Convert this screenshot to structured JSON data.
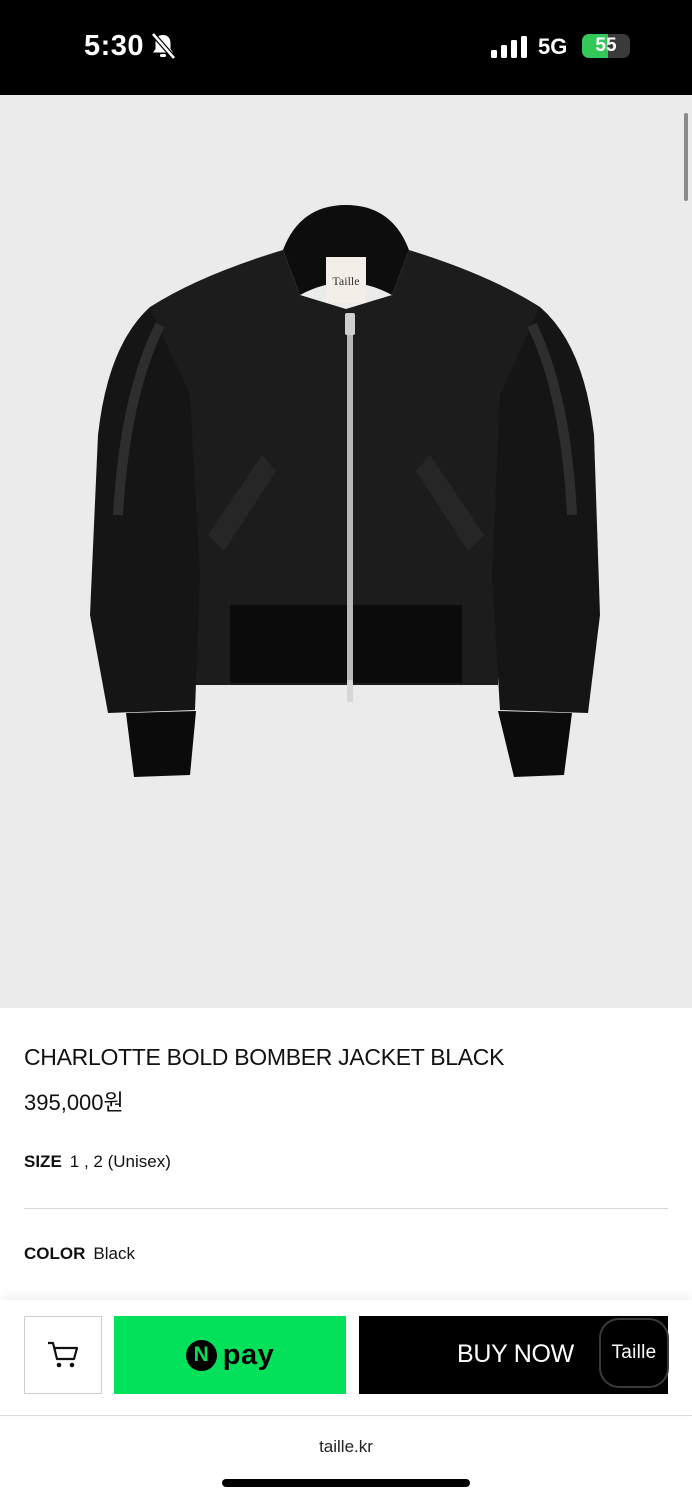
{
  "status_bar": {
    "time": "5:30",
    "network": "5G",
    "battery_level": "55",
    "battery_percent": 55
  },
  "product": {
    "image_label": "Taille",
    "name": "CHARLOTTE BOLD BOMBER JACKET BLACK",
    "price": "395,000원",
    "size_key": "SIZE",
    "size_value": "1 , 2 (Unisex)",
    "color_key": "COLOR",
    "color_value": "Black"
  },
  "actions": {
    "npay_mark": "N",
    "npay_label": "pay",
    "buy_now": "BUY NOW",
    "floating_chip": "Taille"
  },
  "browser": {
    "url": "taille.kr"
  },
  "colors": {
    "npay_green": "#03e05a",
    "battery_green": "#34c759",
    "image_background": "#ebebeb"
  }
}
